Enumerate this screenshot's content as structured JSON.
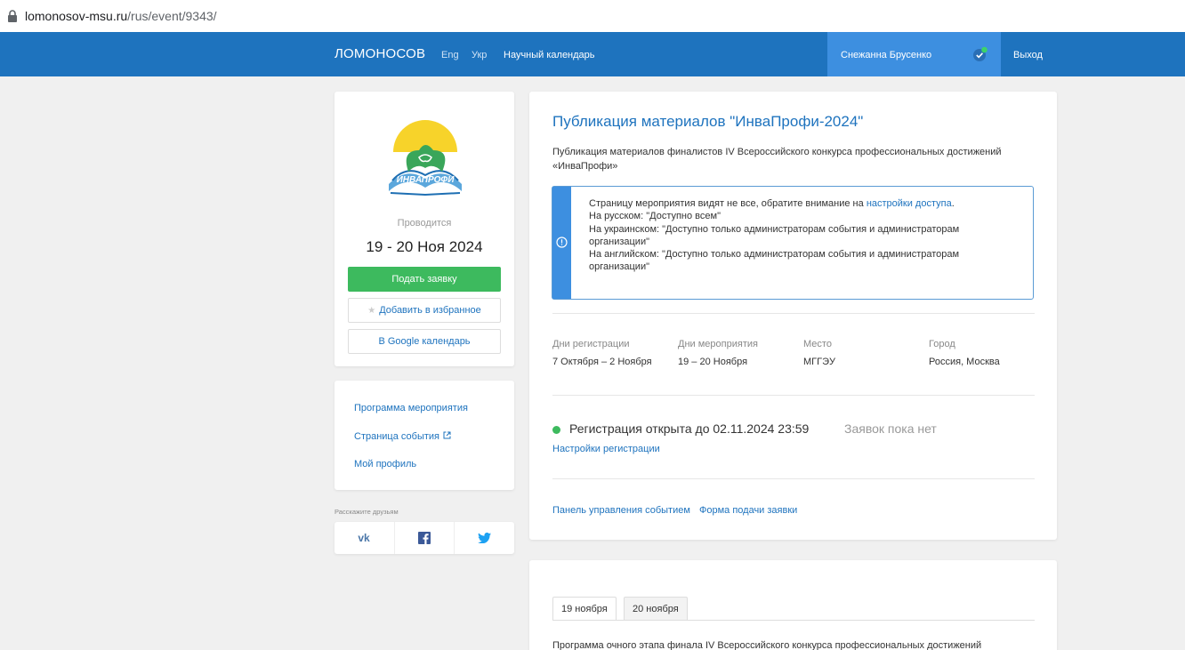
{
  "browser": {
    "url_host": "lomonosov-msu.ru",
    "url_path": "/rus/event/9343/"
  },
  "navbar": {
    "brand": "ЛОМОНОСОВ",
    "lang_en": "Eng",
    "lang_uk": "Укр",
    "calendar": "Научный календарь",
    "user_name": "Снежанна Брусенко",
    "logout": "Выход",
    "bg_color": "#1e73be"
  },
  "event_card": {
    "logo_text": "ИНВАПРОФИ",
    "held_label": "Проводится",
    "dates": "19 - 20 Ноя 2024",
    "apply_button": "Подать заявку",
    "favorite_button": "Добавить в избранное",
    "gcal_button": "В Google календарь"
  },
  "links": {
    "program": "Программа мероприятия",
    "event_page": "Страница события",
    "profile": "Мой профиль"
  },
  "share": {
    "title": "Расскажите друзьям",
    "icons": [
      "vk-icon",
      "facebook-icon",
      "twitter-icon"
    ]
  },
  "main": {
    "title": "Публикация материалов \"ИнваПрофи-2024\"",
    "description": "Публикация материалов финалистов IV Всероссийского конкурса профессиональных достижений «ИнваПрофи»",
    "alert": {
      "line1_prefix": "Страницу мероприятия видят не все, обратите внимание на ",
      "line1_link": "настройки доступа",
      "line1_suffix": ".",
      "line2": "На русском: \"Доступно всем\"",
      "line3": "На украинском: \"Доступно только администраторам события и администраторам организации\"",
      "line4": "На английском: \"Доступно только администраторам события и администраторам организации\""
    },
    "info": [
      {
        "label": "Дни регистрации",
        "value": "7 Октября – 2 Ноября"
      },
      {
        "label": "Дни мероприятия",
        "value": "19 – 20 Ноября"
      },
      {
        "label": "Место",
        "value": "МГГЭУ"
      },
      {
        "label": "Город",
        "value": "Россия, Москва"
      }
    ],
    "registration_status": "Регистрация открыта до 02.11.2024 23:59",
    "applications_count": "Заявок пока нет",
    "registration_settings": "Настройки регистрации",
    "control_panel": "Панель управления событием",
    "application_form": "Форма подачи заявки"
  },
  "program": {
    "tabs": [
      "19 ноября",
      "20 ноября"
    ],
    "text": "Программа очного этапа финала IV Всероссийского конкурса профессиональных достижений"
  }
}
